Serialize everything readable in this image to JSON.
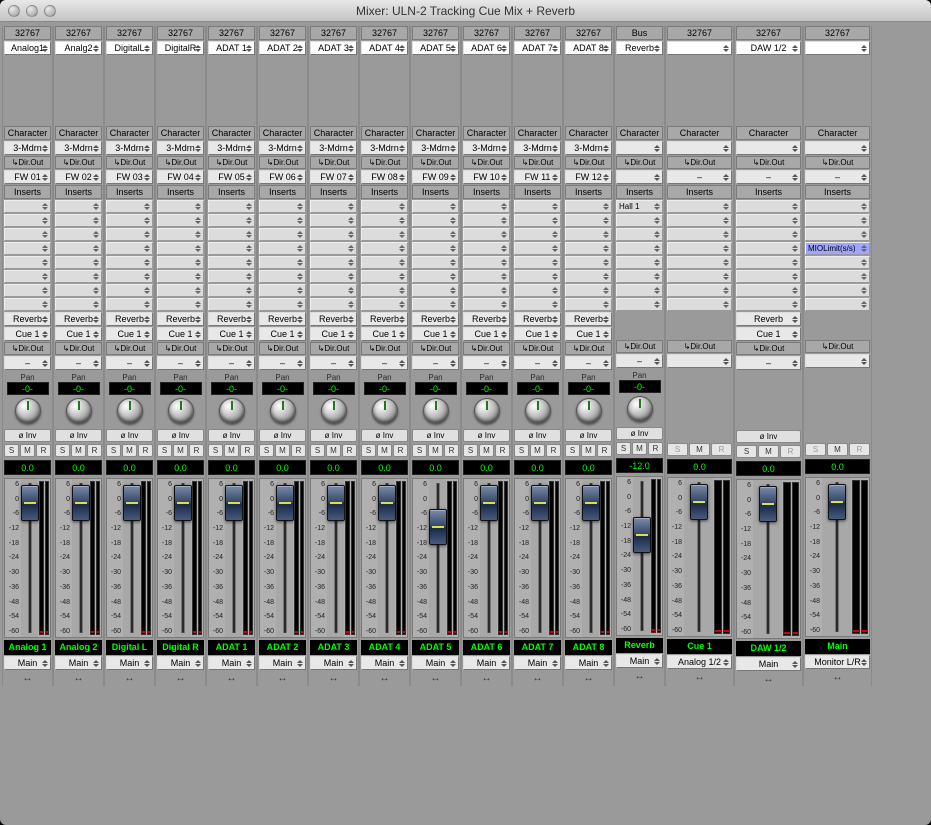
{
  "window": {
    "title": "Mixer: ULN-2 Tracking Cue Mix + Reverb"
  },
  "labels": {
    "character": "Character",
    "dirout": "↳Dir.Out",
    "inserts": "Inserts",
    "reverb": "Reverb",
    "pan": "Pan",
    "inv": "ø Inv",
    "s": "S",
    "m": "M",
    "r": "R",
    "link": "↔",
    "dash": "–"
  },
  "scale": [
    "6",
    "0",
    "-6",
    "-12",
    "-18",
    "-24",
    "-30",
    "-36",
    "-48",
    "-54",
    "-60"
  ],
  "channels": [
    {
      "wide": false,
      "header": "32767",
      "input": "Analog1",
      "char": "3-Mdrn",
      "fw": "FW 01",
      "insert": "",
      "send": "Reverb",
      "cue": "Cue 1",
      "do2": "–",
      "pan": "-0-",
      "smr": [
        1,
        1,
        1
      ],
      "level": "0.0",
      "faderTop": 6,
      "name": "Analog 1",
      "out": "Main"
    },
    {
      "wide": false,
      "header": "32767",
      "input": "Analg2",
      "char": "3-Mdrn",
      "fw": "FW 02",
      "insert": "",
      "send": "Reverb",
      "cue": "Cue 1",
      "do2": "–",
      "pan": "-0-",
      "smr": [
        1,
        1,
        1
      ],
      "level": "0.0",
      "faderTop": 6,
      "name": "Analog 2",
      "out": "Main"
    },
    {
      "wide": false,
      "header": "32767",
      "input": "DigitalL",
      "char": "3-Mdrn",
      "fw": "FW 03",
      "insert": "",
      "send": "Reverb",
      "cue": "Cue 1",
      "do2": "–",
      "pan": "-0-",
      "smr": [
        1,
        1,
        1
      ],
      "level": "0.0",
      "faderTop": 6,
      "name": "Digital L",
      "out": "Main"
    },
    {
      "wide": false,
      "header": "32767",
      "input": "DigitalR",
      "char": "3-Mdrn",
      "fw": "FW 04",
      "insert": "",
      "send": "Reverb",
      "cue": "Cue 1",
      "do2": "–",
      "pan": "-0-",
      "smr": [
        1,
        1,
        1
      ],
      "level": "0.0",
      "faderTop": 6,
      "name": "Digital R",
      "out": "Main"
    },
    {
      "wide": false,
      "header": "32767",
      "input": "ADAT 1",
      "char": "3-Mdrn",
      "fw": "FW 05",
      "insert": "",
      "send": "Reverb",
      "cue": "Cue 1",
      "do2": "–",
      "pan": "-0-",
      "smr": [
        1,
        1,
        1
      ],
      "level": "0.0",
      "faderTop": 6,
      "name": "ADAT 1",
      "out": "Main"
    },
    {
      "wide": false,
      "header": "32767",
      "input": "ADAT 2",
      "char": "3-Mdrn",
      "fw": "FW 06",
      "insert": "",
      "send": "Reverb",
      "cue": "Cue 1",
      "do2": "–",
      "pan": "-0-",
      "smr": [
        1,
        1,
        1
      ],
      "level": "0.0",
      "faderTop": 6,
      "name": "ADAT 2",
      "out": "Main"
    },
    {
      "wide": false,
      "header": "32767",
      "input": "ADAT 3",
      "char": "3-Mdrn",
      "fw": "FW 07",
      "insert": "",
      "send": "Reverb",
      "cue": "Cue 1",
      "do2": "–",
      "pan": "-0-",
      "smr": [
        1,
        1,
        1
      ],
      "level": "0.0",
      "faderTop": 6,
      "name": "ADAT 3",
      "out": "Main"
    },
    {
      "wide": false,
      "header": "32767",
      "input": "ADAT 4",
      "char": "3-Mdrn",
      "fw": "FW 08",
      "insert": "",
      "send": "Reverb",
      "cue": "Cue 1",
      "do2": "–",
      "pan": "-0-",
      "smr": [
        1,
        1,
        1
      ],
      "level": "0.0",
      "faderTop": 6,
      "name": "ADAT 4",
      "out": "Main"
    },
    {
      "wide": false,
      "header": "32767",
      "input": "ADAT 5",
      "char": "3-Mdrn",
      "fw": "FW 09",
      "insert": "",
      "send": "Reverb",
      "cue": "Cue 1",
      "do2": "–",
      "pan": "-0-",
      "smr": [
        1,
        1,
        1
      ],
      "level": "0.0",
      "faderTop": 30,
      "name": "ADAT 5",
      "out": "Main"
    },
    {
      "wide": false,
      "header": "32767",
      "input": "ADAT 6",
      "char": "3-Mdrn",
      "fw": "FW 10",
      "insert": "",
      "send": "Reverb",
      "cue": "Cue 1",
      "do2": "–",
      "pan": "-0-",
      "smr": [
        1,
        1,
        1
      ],
      "level": "0.0",
      "faderTop": 6,
      "name": "ADAT 6",
      "out": "Main"
    },
    {
      "wide": false,
      "header": "32767",
      "input": "ADAT 7",
      "char": "3-Mdrn",
      "fw": "FW 11",
      "insert": "",
      "send": "Reverb",
      "cue": "Cue 1",
      "do2": "–",
      "pan": "-0-",
      "smr": [
        1,
        1,
        1
      ],
      "level": "0.0",
      "faderTop": 6,
      "name": "ADAT 7",
      "out": "Main"
    },
    {
      "wide": false,
      "header": "32767",
      "input": "ADAT 8",
      "char": "3-Mdrn",
      "fw": "FW 12",
      "insert": "",
      "send": "Reverb",
      "cue": "Cue 1",
      "do2": "–",
      "pan": "-0-",
      "smr": [
        1,
        1,
        1
      ],
      "level": "0.0",
      "faderTop": 6,
      "name": "ADAT 8",
      "out": "Main"
    },
    {
      "wide": false,
      "header": "Bus",
      "input": "Reverb",
      "char": "",
      "fw": "",
      "insert": "Hall 1",
      "send": "",
      "cue": "",
      "do2": "–",
      "pan": "-0-",
      "smr": [
        1,
        1,
        1
      ],
      "level": "-12.0",
      "faderTop": 40,
      "name": "Reverb",
      "out": "Main",
      "noFW": true,
      "noReverbSend": true
    },
    {
      "wide": true,
      "header": "32767",
      "input": "",
      "char": "",
      "fw": "–",
      "insert": "",
      "send": "",
      "cue": "",
      "do2": "",
      "pan": "",
      "smr": [
        0,
        1,
        0
      ],
      "level": "0.0",
      "faderTop": 6,
      "name": "Cue 1",
      "out": "Analog 1/2",
      "noPan": true,
      "noInput": true,
      "noReverbSend": true,
      "noInv": true
    },
    {
      "wide": true,
      "header": "32767",
      "input": "DAW 1/2",
      "char": "",
      "fw": "–",
      "insert": "",
      "send": "Reverb",
      "cue": "Cue 1",
      "do2": "–",
      "pan": "",
      "smr": [
        1,
        1,
        0
      ],
      "level": "0.0",
      "faderTop": 6,
      "name": "DAW 1/2",
      "out": "Main",
      "noPan": true
    },
    {
      "wide": true,
      "header": "32767",
      "input": "",
      "char": "",
      "fw": "–",
      "insert": "MIOLimit(s/s)",
      "insertHighlight": true,
      "send": "",
      "cue": "",
      "do2": "",
      "pan": "",
      "smr": [
        0,
        1,
        0
      ],
      "level": "0.0",
      "faderTop": 6,
      "name": "Main",
      "out": "Monitor L/R",
      "noPan": true,
      "noInput": true,
      "noReverbSend": true,
      "noInv": true
    }
  ]
}
